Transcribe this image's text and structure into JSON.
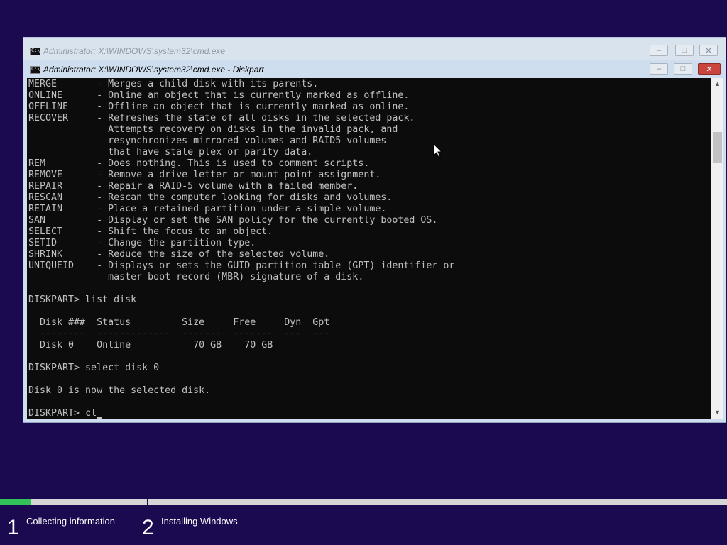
{
  "back_window": {
    "title": "Administrator: X:\\WINDOWS\\system32\\cmd.exe"
  },
  "front_window": {
    "title": "Administrator: X:\\WINDOWS\\system32\\cmd.exe - Diskpart",
    "minimize_label": "–",
    "maximize_label": "□",
    "close_label": "✕"
  },
  "console": {
    "lines": [
      "MERGE       - Merges a child disk with its parents.",
      "ONLINE      - Online an object that is currently marked as offline.",
      "OFFLINE     - Offline an object that is currently marked as online.",
      "RECOVER     - Refreshes the state of all disks in the selected pack.",
      "              Attempts recovery on disks in the invalid pack, and",
      "              resynchronizes mirrored volumes and RAID5 volumes",
      "              that have stale plex or parity data.",
      "REM         - Does nothing. This is used to comment scripts.",
      "REMOVE      - Remove a drive letter or mount point assignment.",
      "REPAIR      - Repair a RAID-5 volume with a failed member.",
      "RESCAN      - Rescan the computer looking for disks and volumes.",
      "RETAIN      - Place a retained partition under a simple volume.",
      "SAN         - Display or set the SAN policy for the currently booted OS.",
      "SELECT      - Shift the focus to an object.",
      "SETID       - Change the partition type.",
      "SHRINK      - Reduce the size of the selected volume.",
      "UNIQUEID    - Displays or sets the GUID partition table (GPT) identifier or",
      "              master boot record (MBR) signature of a disk.",
      "",
      "DISKPART> list disk",
      "",
      "  Disk ###  Status         Size     Free     Dyn  Gpt",
      "  --------  -------------  -------  -------  ---  ---",
      "  Disk 0    Online           70 GB    70 GB",
      "",
      "DISKPART> select disk 0",
      "",
      "Disk 0 is now the selected disk.",
      ""
    ],
    "prompt": "DISKPART> ",
    "current_input": "cl"
  },
  "scrollbar": {
    "up_arrow": "▲",
    "down_arrow": "▼"
  },
  "setup_progress": {
    "progress_fraction": 0.043,
    "steps": [
      {
        "number": "1",
        "label": "Collecting information"
      },
      {
        "number": "2",
        "label": "Installing Windows"
      }
    ]
  },
  "colors": {
    "background": "#1b0a4f",
    "console_bg": "#0c0c0c",
    "console_text": "#c0c0c0",
    "progress_fill": "#31c35a"
  }
}
